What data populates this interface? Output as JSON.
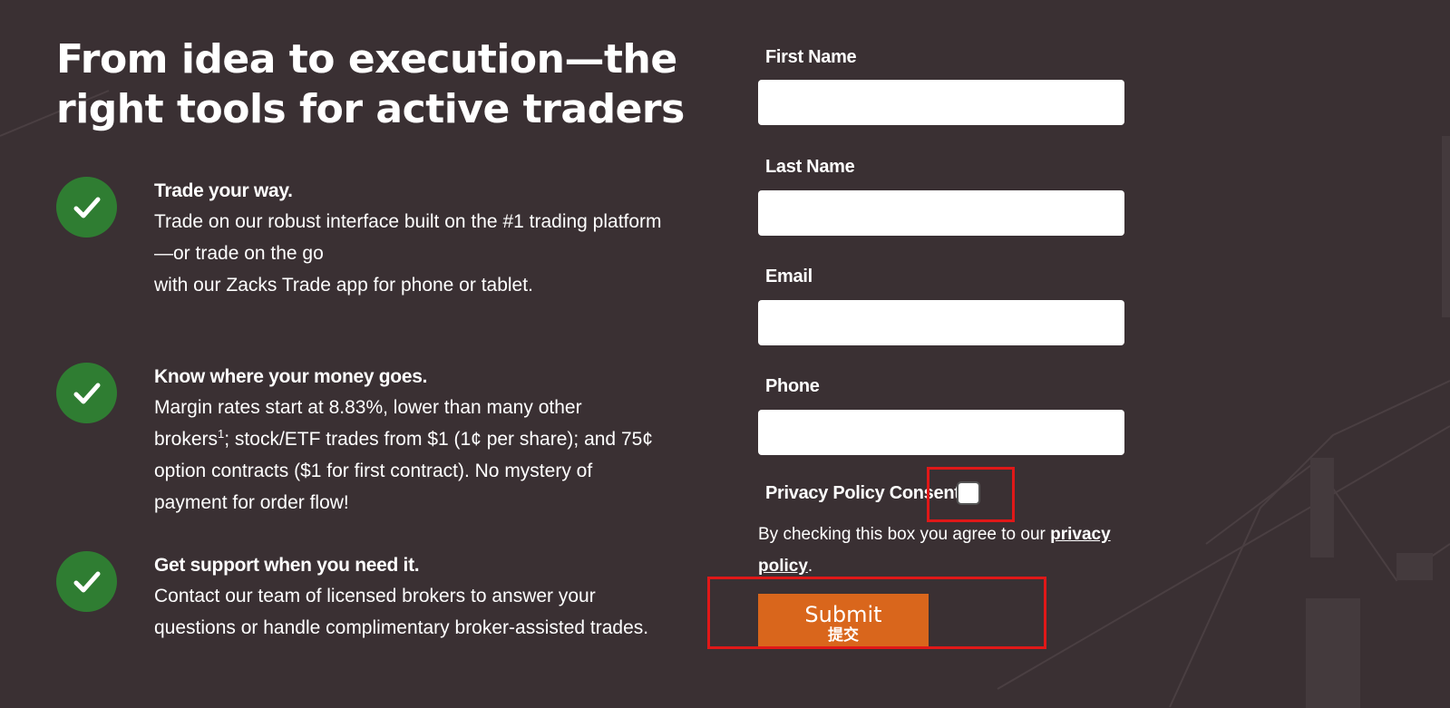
{
  "headline": "From idea to execution—the right tools for active traders",
  "features": [
    {
      "title": "Trade your way.",
      "lines": [
        "Trade on our robust interface built on the #1 trading platform—or trade on the go",
        "with our Zacks Trade app for phone or tablet."
      ]
    },
    {
      "title": "Know where your money goes.",
      "body_pre": "Margin rates start at 8.83%, lower than many other brokers",
      "footnote": "1",
      "body_post": "; stock/ETF trades from $1 (1¢ per share); and 75¢ option contracts ($1 for first contract). No mystery of payment for order flow!"
    },
    {
      "title": "Get support when you need it.",
      "lines": [
        "Contact our team of licensed brokers to answer your questions or handle complimentary broker-assisted trades."
      ]
    }
  ],
  "form": {
    "first_name_label": "First Name",
    "first_name_value": "",
    "last_name_label": "Last Name",
    "last_name_value": "",
    "email_label": "Email",
    "email_value": "",
    "phone_label": "Phone",
    "phone_value": "",
    "consent_label": "Privacy Policy Consent:",
    "consent_checked": false,
    "consent_note_pre": "By checking this box you agree to our ",
    "consent_link": "privacy policy",
    "consent_note_post": ".",
    "submit_label": "Submit",
    "submit_sublabel": "提交"
  },
  "colors": {
    "background": "#3a3033",
    "check_badge": "#2f7d32",
    "submit_button": "#d9661c",
    "highlight": "#e01818"
  },
  "icons": [
    "check-icon"
  ]
}
